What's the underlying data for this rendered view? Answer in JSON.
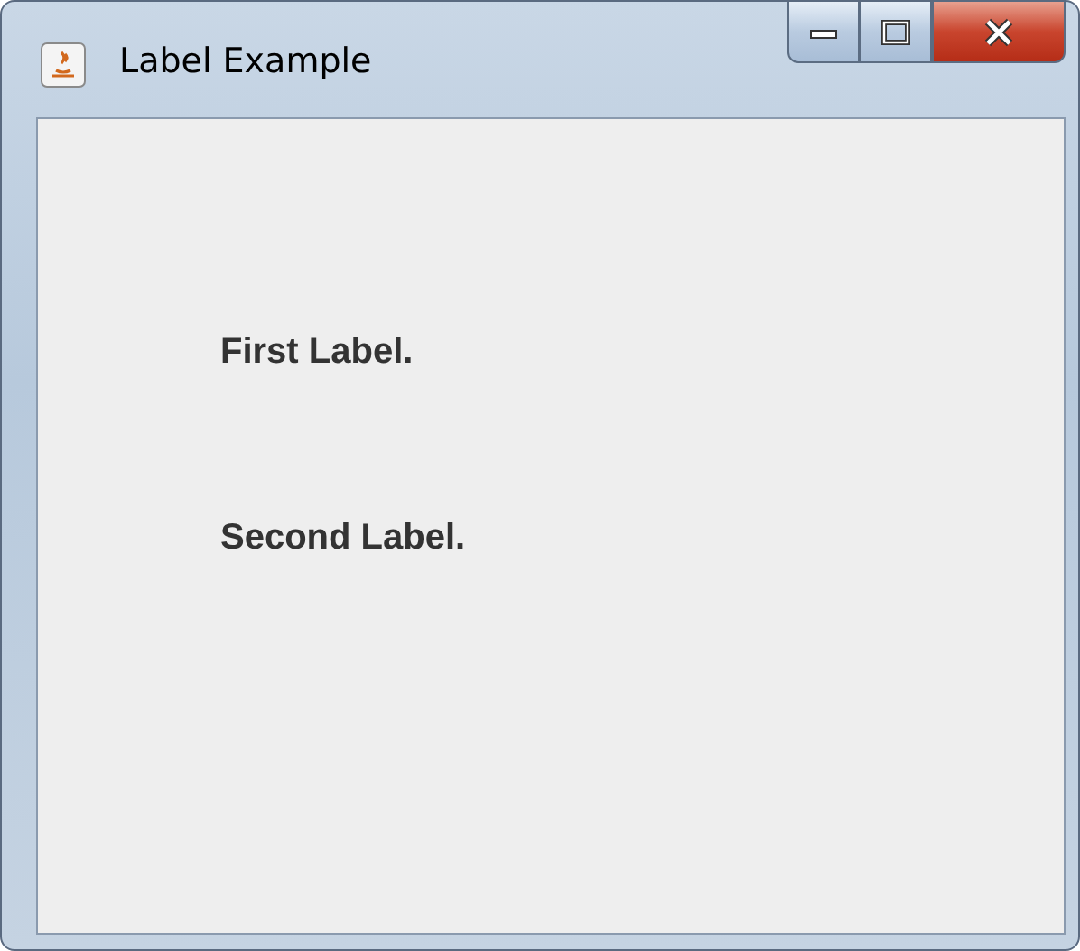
{
  "window": {
    "title": "Label Example"
  },
  "labels": [
    "First Label.",
    "Second Label."
  ]
}
